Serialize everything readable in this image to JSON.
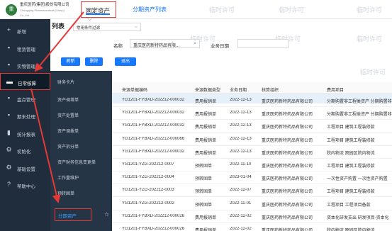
{
  "header": {
    "logo_mark": "重",
    "company_name": "重庆医药(集团)股份有限公司",
    "company_sub": "Chongqing Pharmaceutical (Group) Co.,Ltd.",
    "active_tab": "固定资产",
    "second_tab": "分期资产列表"
  },
  "watermarks": [
    "临时许可",
    "临时许可",
    "临时许可",
    "临时许可",
    "临时许可",
    "临时许可",
    "临时许可"
  ],
  "sidebar": {
    "items": [
      {
        "icon": "plus-icon",
        "glyph": "+",
        "label": "新增"
      },
      {
        "icon": "briefcase-icon",
        "glyph": "▪",
        "label": "租赁管理"
      },
      {
        "icon": "store-icon",
        "glyph": "▪",
        "label": "实物管理"
      },
      {
        "icon": "monitor-icon",
        "glyph": "▬",
        "label": "日常核算"
      },
      {
        "icon": "calendar-icon",
        "glyph": "▪",
        "label": "盘点管理"
      },
      {
        "icon": "screen-icon",
        "glyph": "▪",
        "label": "期末处理"
      },
      {
        "icon": "chart-icon",
        "glyph": "▮",
        "label": "统计报表"
      },
      {
        "icon": "gear-icon",
        "glyph": "⚙",
        "label": "初始化"
      },
      {
        "icon": "settings-icon",
        "glyph": "⚙",
        "label": "基础设置"
      },
      {
        "icon": "help-icon",
        "glyph": "?",
        "label": "帮助中心"
      }
    ]
  },
  "submenu": {
    "items": [
      "财务卡片",
      "资产调增单",
      "资产处置单",
      "资产调拨单",
      "资产拆分单",
      "资产财务信息变更单",
      "工作量维护",
      "预转固单"
    ],
    "selected": "分期资产"
  },
  "page": {
    "title": "列表",
    "filter_value": "常用条件过滤",
    "org_label": "名称",
    "org_value": "重庆医药新特药品有限...",
    "date_label": "业务日期",
    "buttons": [
      "刷新",
      "删除",
      "退出"
    ]
  },
  "table": {
    "columns": [
      "来源单据编码",
      "来源数据类型",
      "业务日期",
      "核算组织",
      "费用项目"
    ],
    "rows": [
      [
        "YG1201-FYBXD-202212-000032",
        "费用报销单",
        "2022-12-13",
        "重庆医药新特药品有限公司",
        "分期购置非工程类资产 分期购置非"
      ],
      [
        "YG1201-FYBXD-202212-000032",
        "费用报销单",
        "2022-12-13",
        "重庆医药新特药品有限公司",
        "分期购置非工程类资产 分期购置非"
      ],
      [
        "YG1201-FYBXD-202212-000032",
        "费用报销单",
        "2022-12-13",
        "重庆医药新特药品有限公司",
        "工程项目 建筑工程装修款"
      ],
      [
        "YG1201-FYBXD-202212-000066",
        "费用报销单",
        "2022-12-13",
        "重庆医药新特药品有限公司",
        "工程项目 建筑工程装修款"
      ],
      [
        "YG1201-FYBXD-202212-000032",
        "费用报销单",
        "2022-12-13",
        "重庆医药新特药品有限公司",
        "院内物流 跨园区院内物流"
      ],
      [
        "YG1201-YZG-202212-0007",
        "预转固单",
        "2022-11-10",
        "重庆医药新特药品有限公司",
        "工程项目 建筑工程装修款"
      ],
      [
        "YG1201-YZG-202212-0004",
        "预转固单",
        "2023-01-04",
        "重庆医药新特药品有限公司",
        "一次性资产购置 一次性资产购置"
      ],
      [
        "YG1201-YZG-202212-0003",
        "预转固单",
        "2022-12-07",
        "重庆医药新特药品有限公司",
        "工程项目 建筑工程装修款"
      ],
      [
        "YG1201-YZG-202212-0002",
        "预转固单",
        "2022-11-01",
        "重庆医药新特药品有限公司",
        "工程项目 工程项目备款"
      ],
      [
        "YG1201-FYBXD-202212-000026",
        "费用报销单",
        "2022-12-02",
        "重庆医药新特药品有限公司",
        "资本化研发支出 研发项目-资本化"
      ],
      [
        "YG1201-FYBXD-202212-000026",
        "费用报销单",
        "2022-12-02",
        "重庆医药新特药品有限公司",
        "院内物流 跨园区院内物流"
      ]
    ]
  }
}
